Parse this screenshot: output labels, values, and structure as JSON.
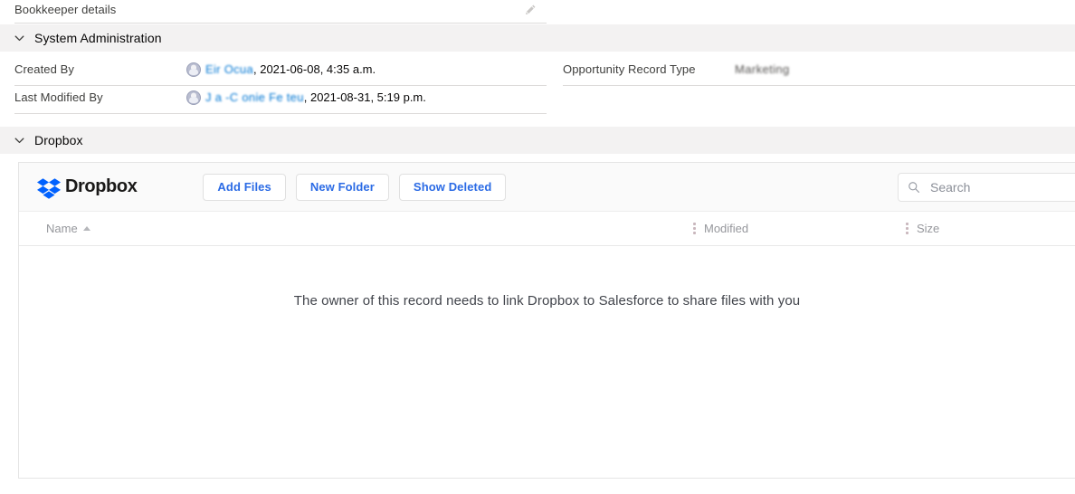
{
  "top_field": {
    "label": "Bookkeeper details",
    "edit_icon": "pencil-icon"
  },
  "sections": [
    {
      "id": "system-administration",
      "title": "System Administration",
      "expanded": true,
      "chevron_icon": "chevron-down-icon"
    },
    {
      "id": "dropbox",
      "title": "Dropbox",
      "expanded": true,
      "chevron_icon": "chevron-down-icon"
    }
  ],
  "system_administration": {
    "left_fields": [
      {
        "label": "Created By",
        "person": "Eir  Ocua",
        "person_redacted": true,
        "date": ", 2021-06-08, 4:35 a.m.",
        "avatar_icon": "user-avatar-icon"
      },
      {
        "label": "Last Modified By",
        "person": "J a -C  onie Fe teu",
        "person_redacted": true,
        "date": ", 2021-08-31, 5:19 p.m.",
        "avatar_icon": "user-avatar-icon"
      }
    ],
    "right_fields": [
      {
        "label": "Opportunity Record Type",
        "value": "Marketing",
        "value_redacted": true
      }
    ]
  },
  "dropbox": {
    "brand": "Dropbox",
    "brand_color": "#0061fe",
    "logo_icon": "dropbox-logo-icon",
    "buttons": [
      {
        "label": "Add Files",
        "name": "add-files-button"
      },
      {
        "label": "New Folder",
        "name": "new-folder-button"
      },
      {
        "label": "Show Deleted",
        "name": "show-deleted-button"
      }
    ],
    "search": {
      "placeholder": "Search",
      "value": "",
      "icon": "search-icon"
    },
    "table": {
      "columns": [
        {
          "label": "Name",
          "sort": "asc",
          "sort_icon": "sort-ascending-icon",
          "resizable": false
        },
        {
          "label": "Modified",
          "sort": "none",
          "resize_icon": "column-resize-grip-icon",
          "resizable": true
        },
        {
          "label": "Size",
          "sort": "none",
          "resize_icon": "column-resize-grip-icon",
          "resizable": true
        }
      ],
      "rows": [],
      "empty_message": "The owner of this record needs to link Dropbox to Salesforce to share files with you"
    }
  },
  "colors": {
    "link_blue": "#0176d3",
    "dropbox_blue": "#0061fe",
    "button_blue": "#2b6be5",
    "section_band": "#f3f2f2",
    "rule": "#dddbda"
  }
}
